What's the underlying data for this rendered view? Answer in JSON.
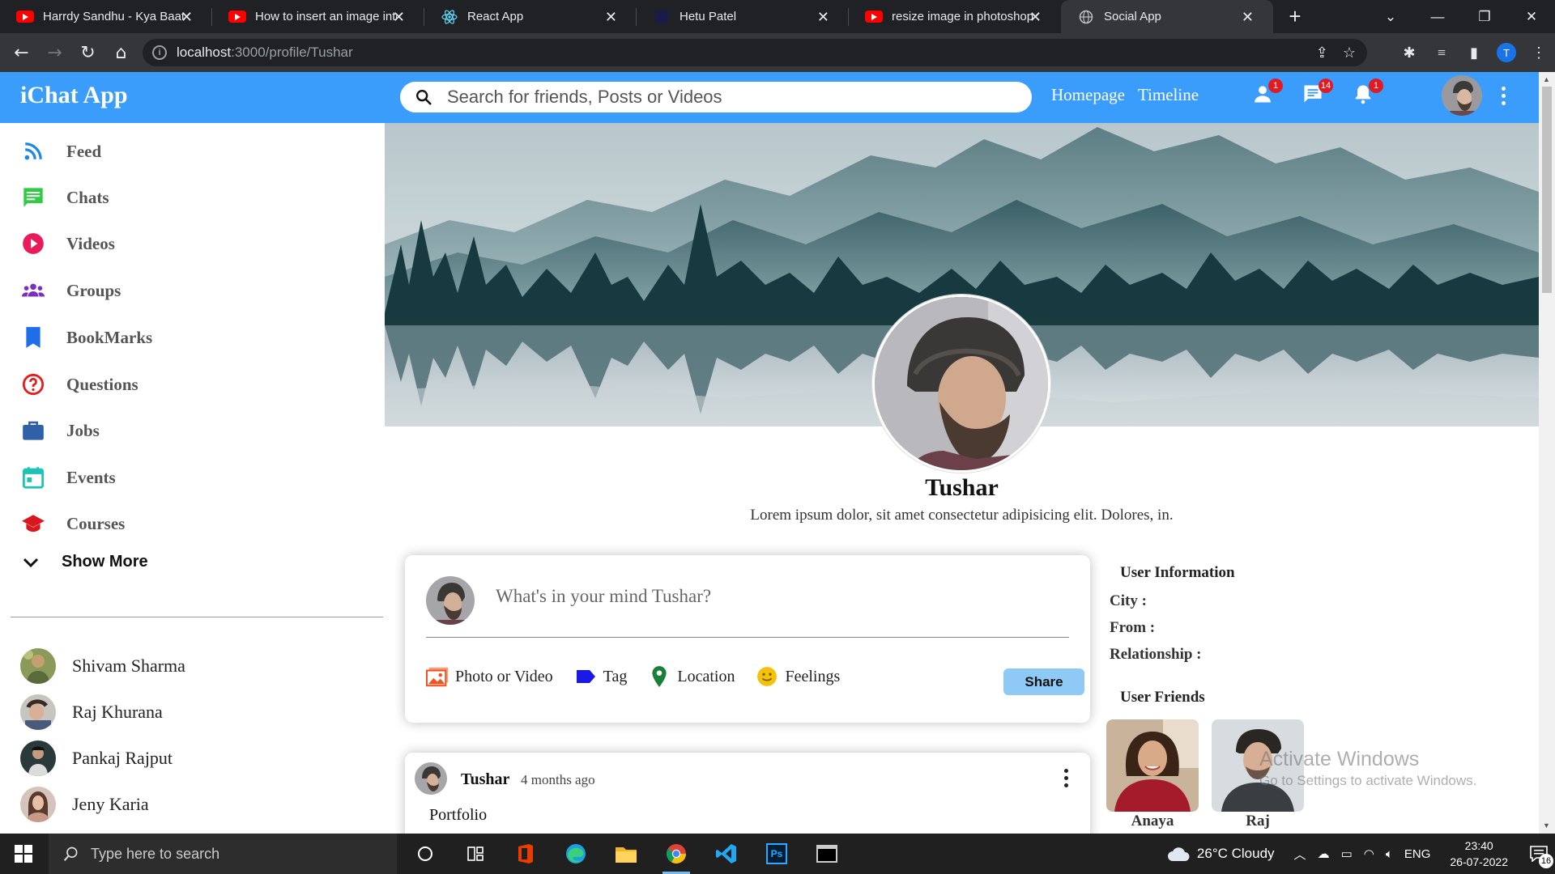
{
  "browser": {
    "tabs": [
      {
        "title": "Harrdy Sandhu - Kya Baat Ay",
        "icon": "youtube-icon"
      },
      {
        "title": "How to insert an image into",
        "icon": "youtube-icon"
      },
      {
        "title": "React App",
        "icon": "react-icon"
      },
      {
        "title": "Hetu Patel",
        "icon": "site-icon"
      },
      {
        "title": "resize image in photoshop",
        "icon": "youtube-icon"
      },
      {
        "title": "Social App",
        "icon": "globe-icon"
      }
    ],
    "active_tab": 5,
    "url_host": "localhost",
    "url_path": ":3000/profile/Tushar",
    "profile_initial": "T"
  },
  "topbar": {
    "logo": "iChat App",
    "search_placeholder": "Search for friends, Posts or Videos",
    "links": [
      "Homepage",
      "Timeline"
    ],
    "badges": {
      "friends": "1",
      "messages": "14",
      "notifications": "1"
    },
    "color": "#3a9dfc"
  },
  "sidebar": {
    "items": [
      {
        "label": "Feed",
        "icon": "rss-feed-icon",
        "color": "#1e88e5"
      },
      {
        "label": "Chats",
        "icon": "chat-icon",
        "color": "#2ecc40"
      },
      {
        "label": "Videos",
        "icon": "play-circle-icon",
        "color": "#ea1a5b"
      },
      {
        "label": "Groups",
        "icon": "groups-icon",
        "color": "#7b2fbf"
      },
      {
        "label": "BookMarks",
        "icon": "bookmark-icon",
        "color": "#1e6ee8"
      },
      {
        "label": "Questions",
        "icon": "help-circle-icon",
        "color": "#e81c1c"
      },
      {
        "label": "Jobs",
        "icon": "briefcase-icon",
        "color": "#2f60a8"
      },
      {
        "label": "Events",
        "icon": "calendar-icon",
        "color": "#1ec3b5"
      },
      {
        "label": "Courses",
        "icon": "graduation-cap-icon",
        "color": "#d8181f"
      }
    ],
    "show_more": "Show More",
    "friends": [
      {
        "name": "Shivam Sharma"
      },
      {
        "name": "Raj Khurana"
      },
      {
        "name": "Pankaj Rajput"
      },
      {
        "name": "Jeny Karia"
      }
    ]
  },
  "profile": {
    "name": "Tushar",
    "description": "Lorem ipsum dolor, sit amet consectetur adipisicing elit. Dolores, in."
  },
  "share": {
    "placeholder": "What's in your mind Tushar?",
    "options": [
      {
        "label": "Photo or Video",
        "icon": "photo-icon",
        "color": "#f4511e"
      },
      {
        "label": "Tag",
        "icon": "label-icon",
        "color": "#1a1ae6"
      },
      {
        "label": "Location",
        "icon": "location-pin-icon",
        "color": "#188038"
      },
      {
        "label": "Feelings",
        "icon": "emoji-icon",
        "color": "#f4c20d"
      }
    ],
    "button": "Share"
  },
  "post": {
    "user": "Tushar",
    "time": "4 months ago",
    "text": "Portfolio"
  },
  "user_info": {
    "title": "User Information",
    "rows": [
      "City :",
      "From :",
      "Relationship :"
    ],
    "friends_title": "User Friends",
    "friends": [
      {
        "name": "Anaya"
      },
      {
        "name": "Raj"
      }
    ]
  },
  "watermark": {
    "line1": "Activate Windows",
    "line2": "Go to Settings to activate Windows."
  },
  "taskbar": {
    "search_placeholder": "Type here to search",
    "weather": "26°C  Cloudy",
    "lang": "ENG",
    "time": "23:40",
    "date": "26-07-2022",
    "notifications": "16"
  }
}
